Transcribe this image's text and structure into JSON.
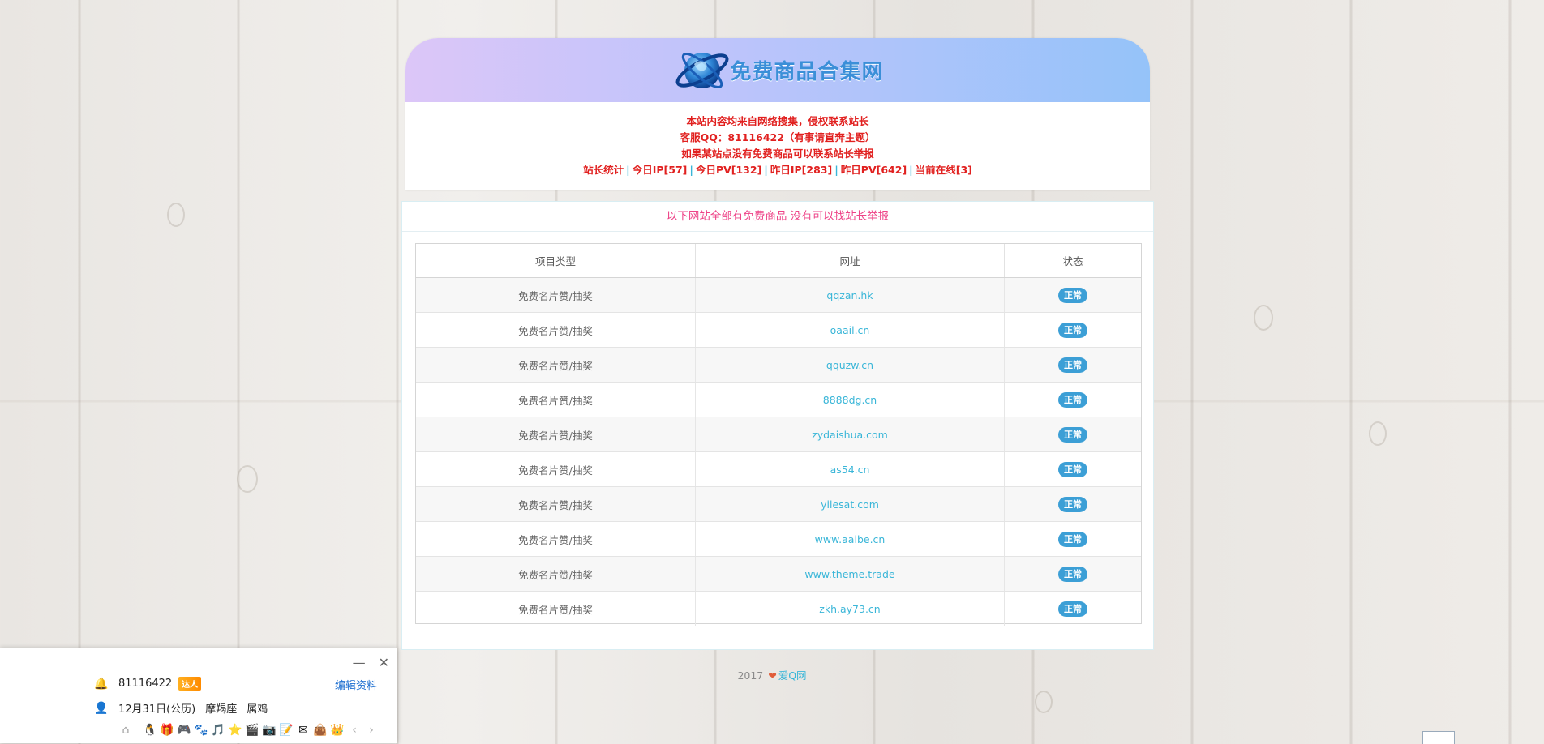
{
  "site": {
    "logo_text": "免费商品合集网",
    "notice_lines": [
      "本站内容均来自网络搜集，侵权联系站长",
      "客服QQ：81116422（有事请直奔主题）",
      "如果某站点没有免费商品可以联系站长举报"
    ],
    "stats": [
      "站长统计",
      "今日IP[57]",
      "今日PV[132]",
      "昨日IP[283]",
      "昨日PV[642]",
      "当前在线[3]"
    ],
    "stats_separator": "|"
  },
  "main": {
    "heading": "以下网站全部有免费商品 没有可以找站长举报",
    "columns": [
      "项目类型",
      "网址",
      "状态"
    ],
    "rows": [
      {
        "type": "免费名片赞/抽奖",
        "url": "qqzan.hk",
        "status": "正常"
      },
      {
        "type": "免费名片赞/抽奖",
        "url": "oaail.cn",
        "status": "正常"
      },
      {
        "type": "免费名片赞/抽奖",
        "url": "qquzw.cn",
        "status": "正常"
      },
      {
        "type": "免费名片赞/抽奖",
        "url": "8888dg.cn",
        "status": "正常"
      },
      {
        "type": "免费名片赞/抽奖",
        "url": "zydaishua.com",
        "status": "正常"
      },
      {
        "type": "免费名片赞/抽奖",
        "url": "as54.cn",
        "status": "正常"
      },
      {
        "type": "免费名片赞/抽奖",
        "url": "yilesat.com",
        "status": "正常"
      },
      {
        "type": "免费名片赞/抽奖",
        "url": "www.aaibe.cn",
        "status": "正常"
      },
      {
        "type": "免费名片赞/抽奖",
        "url": "www.theme.trade",
        "status": "正常"
      },
      {
        "type": "免费名片赞/抽奖",
        "url": "zkh.ay73.cn",
        "status": "正常"
      }
    ]
  },
  "footer": {
    "year": "2017",
    "heart": "❤",
    "brand": "爱Q网"
  },
  "qq_panel": {
    "qq_number": "81116422",
    "vip_badge": "达人",
    "edit_label": "编辑资料",
    "birthday": "12月31日(公历)",
    "zodiac": "摩羯座",
    "chinese_zodiac": "属鸡",
    "minimize_glyph": "—",
    "close_glyph": "✕",
    "nav_prev": "‹",
    "nav_next": "›"
  },
  "colors": {
    "accent": "#3ab6d8",
    "notice_red": "#e1201f",
    "heading_pink": "#ee4488",
    "badge_blue": "#3c9fd6"
  }
}
